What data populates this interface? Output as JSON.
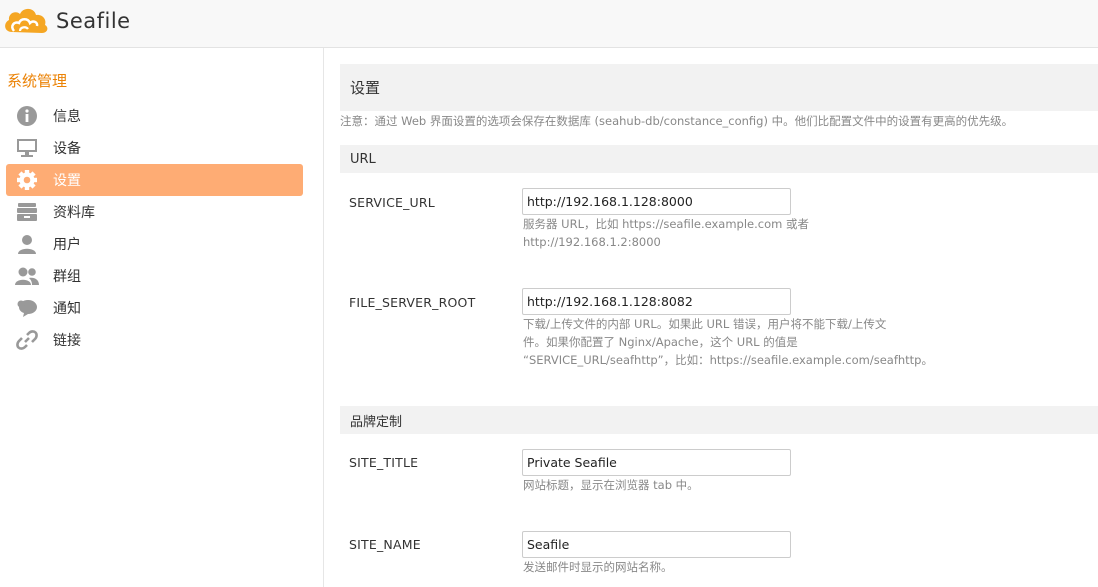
{
  "header": {
    "logo_text": "Seafile",
    "brand_color": "#f5a623"
  },
  "sidebar": {
    "heading": "系统管理",
    "items": [
      {
        "label": "信息",
        "icon": "info-icon",
        "active": false
      },
      {
        "label": "设备",
        "icon": "monitor-icon",
        "active": false
      },
      {
        "label": "设置",
        "icon": "gear-icon",
        "active": true
      },
      {
        "label": "资料库",
        "icon": "library-icon",
        "active": false
      },
      {
        "label": "用户",
        "icon": "user-icon",
        "active": false
      },
      {
        "label": "群组",
        "icon": "group-icon",
        "active": false
      },
      {
        "label": "通知",
        "icon": "notification-icon",
        "active": false
      },
      {
        "label": "链接",
        "icon": "link-icon",
        "active": false
      }
    ],
    "active_color": "#feac74"
  },
  "main": {
    "title": "设置",
    "notice": "注意：通过 Web 界面设置的选项会保存在数据库 (seahub-db/constance_config) 中。他们比配置文件中的设置有更高的优先级。",
    "sections": {
      "url": {
        "title": "URL",
        "service_url": {
          "label": "SERVICE_URL",
          "value": "http://192.168.1.128:8000",
          "help_line1": "服务器 URL，比如 https://seafile.example.com 或者",
          "help_line2": "http://192.168.1.2:8000"
        },
        "file_server_root": {
          "label": "FILE_SERVER_ROOT",
          "value": "http://192.168.1.128:8082",
          "help_line1": "下载/上传文件的内部 URL。如果此 URL 错误，用户将不能下载/上传文",
          "help_line2": "件。如果你配置了 Nginx/Apache，这个 URL 的值是",
          "help_line3": "“SERVICE_URL/seafhttp”，比如：https://seafile.example.com/seafhttp。"
        }
      },
      "branding": {
        "title": "品牌定制",
        "site_title": {
          "label": "SITE_TITLE",
          "value": "Private Seafile",
          "help": "网站标题，显示在浏览器 tab 中。"
        },
        "site_name": {
          "label": "SITE_NAME",
          "value": "Seafile",
          "help": "发送邮件时显示的网站名称。"
        }
      }
    }
  }
}
